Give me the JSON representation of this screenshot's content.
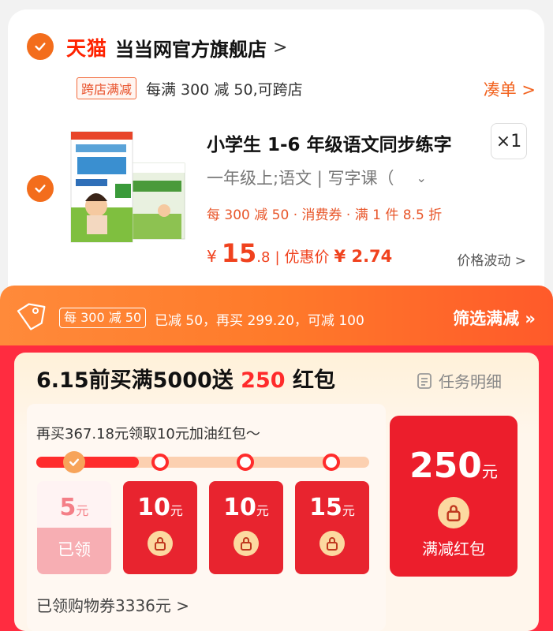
{
  "store": {
    "platform": "天猫",
    "name": "当当网官方旗舰店",
    "arrow": ">"
  },
  "cross_store_promo": {
    "tag": "跨店满减",
    "text": "每满 300 减 50,可跨店",
    "action": "凑单 >"
  },
  "product": {
    "title": "小学生 1-6 年级语文同步练字",
    "quantity": "×1",
    "spec": "一年级上;语文 | 写字课（",
    "spec_caret": "⌄",
    "discounts": "每 300 减 50 · 消费券 · 满 1 件 8.5 折",
    "price_symbol": "¥",
    "price_int": "15",
    "price_dec": ".8",
    "price_sep": "|",
    "discount_label": "优惠价",
    "discount_price": "¥ 2.74",
    "price_fluct": "价格波动 >"
  },
  "promo_bar": {
    "tag": "每 300 减 50",
    "text": "已减 50，再买 299.20，可减 100",
    "filter": "筛选满减 »"
  },
  "task": {
    "title_prefix": "6.15前买满5000送 ",
    "title_amount": "250",
    "title_suffix": " 红包",
    "detail": "任务明细",
    "progress_msg": "再买367.18元领取10元加油红包～",
    "progress": 0.22,
    "rewards": [
      {
        "amount": "5",
        "unit": "元",
        "status": "已领"
      },
      {
        "amount": "10",
        "unit": "元",
        "status": "locked"
      },
      {
        "amount": "10",
        "unit": "元",
        "status": "locked"
      },
      {
        "amount": "15",
        "unit": "元",
        "status": "locked"
      }
    ],
    "big_reward": {
      "amount": "250",
      "unit": "元",
      "label": "满减红包"
    },
    "coupons": "已领购物券3336元 >"
  },
  "colors": {
    "brand_orange": "#f36d1c",
    "price_red": "#f0421e",
    "banner_red": "#ff2c40"
  },
  "icons": [
    "check-icon",
    "tag-icon",
    "list-icon",
    "lock-icon"
  ]
}
